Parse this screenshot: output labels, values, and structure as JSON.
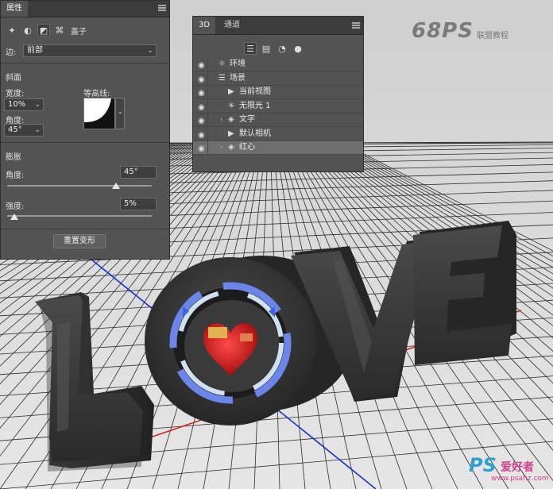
{
  "properties_panel": {
    "tab_label": "属性",
    "section_icon_label": "盖子",
    "side_label": "边:",
    "side_value": "前部",
    "bevel_label": "斜面",
    "width_label": "宽度:",
    "width_value": "10%",
    "contour_label": "等高线:",
    "angle_label": "角度:",
    "angle_value": "45°",
    "inflate_label": "膨胀",
    "inflate_angle_label": "角度:",
    "inflate_angle_value": "45°",
    "inflate_angle_level": 0.75,
    "strength_label": "强度:",
    "strength_value": "5%",
    "strength_level": 0.05,
    "reset_button": "重置变形"
  },
  "panel_3d": {
    "tab_3d": "3D",
    "tab_channels": "通道",
    "layers": [
      {
        "name": "环境",
        "icon": "environment-icon",
        "indent": 0,
        "arrow": false,
        "selected": false
      },
      {
        "name": "场景",
        "icon": "scene-icon",
        "indent": 0,
        "arrow": false,
        "selected": false
      },
      {
        "name": "当前视图",
        "icon": "camera-icon",
        "indent": 1,
        "arrow": false,
        "selected": false
      },
      {
        "name": "无限光 1",
        "icon": "light-icon",
        "indent": 1,
        "arrow": false,
        "selected": false
      },
      {
        "name": "文字",
        "icon": "mesh-icon",
        "indent": 1,
        "arrow": true,
        "selected": false
      },
      {
        "name": "默认相机",
        "icon": "camera-icon",
        "indent": 1,
        "arrow": false,
        "selected": false
      },
      {
        "name": "红心",
        "icon": "mesh-icon",
        "indent": 1,
        "arrow": true,
        "selected": true
      }
    ]
  },
  "scene": {
    "logo_text": "68PS",
    "logo_sub": "联盟教程",
    "watermark_ps": "PS",
    "watermark_cn": "爱好者",
    "watermark_url": "www.psahz.com"
  }
}
